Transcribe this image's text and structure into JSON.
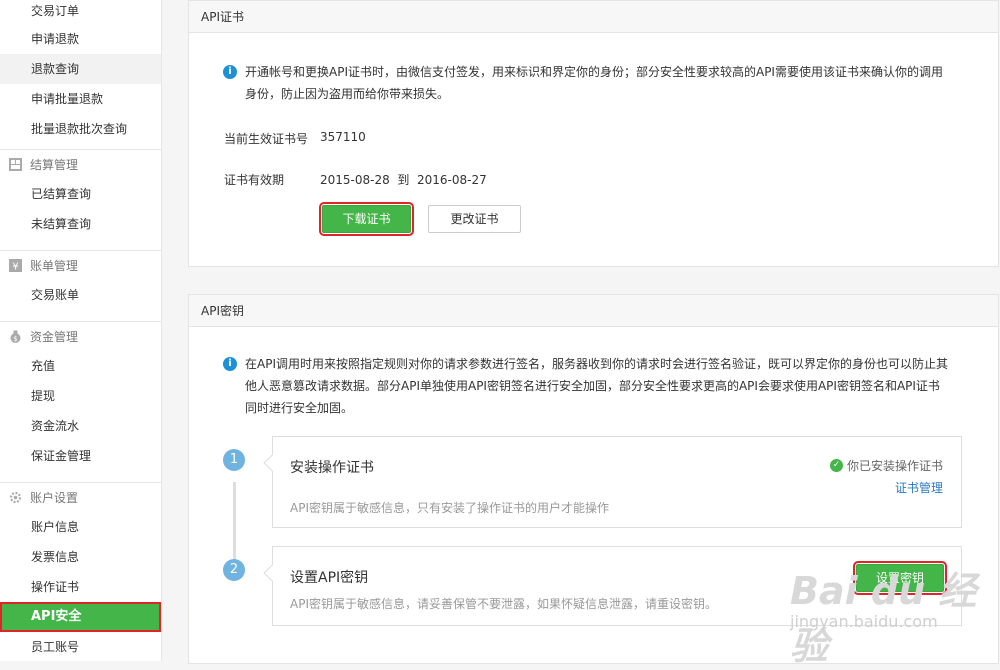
{
  "sidebar": {
    "trade_items": [
      "交易订单",
      "申请退款",
      "退款查询",
      "申请批量退款",
      "批量退款批次查询"
    ],
    "settle_group": "结算管理",
    "settle_items": [
      "已结算查询",
      "未结算查询"
    ],
    "bill_group": "账单管理",
    "bill_items": [
      "交易账单"
    ],
    "fund_group": "资金管理",
    "fund_items": [
      "充值",
      "提现",
      "资金流水",
      "保证金管理"
    ],
    "account_group": "账户设置",
    "account_items": [
      "账户信息",
      "发票信息",
      "操作证书",
      "API安全",
      "员工账号"
    ]
  },
  "cert_panel": {
    "title": "API证书",
    "notice_line1": "开通帐号和更换API证书时，由微信支付签发，用来标识和界定你的身份；部分安全性要求较高的API需要使用该证书来确认你的调用",
    "notice_line2": "身份，防止因为盗用而给你带来损失。",
    "serial_label": "当前生效证书号",
    "serial_value": "357110",
    "validity_label": "证书有效期",
    "validity_value": "2015-08-28  到  2016-08-27",
    "download_button": "下载证书",
    "change_button": "更改证书"
  },
  "key_panel": {
    "title": "API密钥",
    "notice_line1": "在API调用时用来按照指定规则对你的请求参数进行签名，服务器收到你的请求时会进行签名验证，既可以界定你的身份也可以防止其",
    "notice_line2": "他人恶意篡改请求数据。部分API单独使用API密钥签名进行安全加固，部分安全性要求更高的API会要求使用API密钥签名和API证书",
    "notice_line3": "同时进行安全加固。",
    "step1": {
      "num": "1",
      "title": "安装操作证书",
      "status": "你已安装操作证书",
      "link": "证书管理",
      "desc": "API密钥属于敏感信息，只有安装了操作证书的用户才能操作"
    },
    "step2": {
      "num": "2",
      "title": "设置API密钥",
      "button": "设置密钥",
      "desc": "API密钥属于敏感信息，请妥善保管不要泄露，如果怀疑信息泄露，请重设密钥。"
    }
  },
  "watermark": {
    "main": "Bai du 经验",
    "sub": "jingyan.baidu.com"
  }
}
